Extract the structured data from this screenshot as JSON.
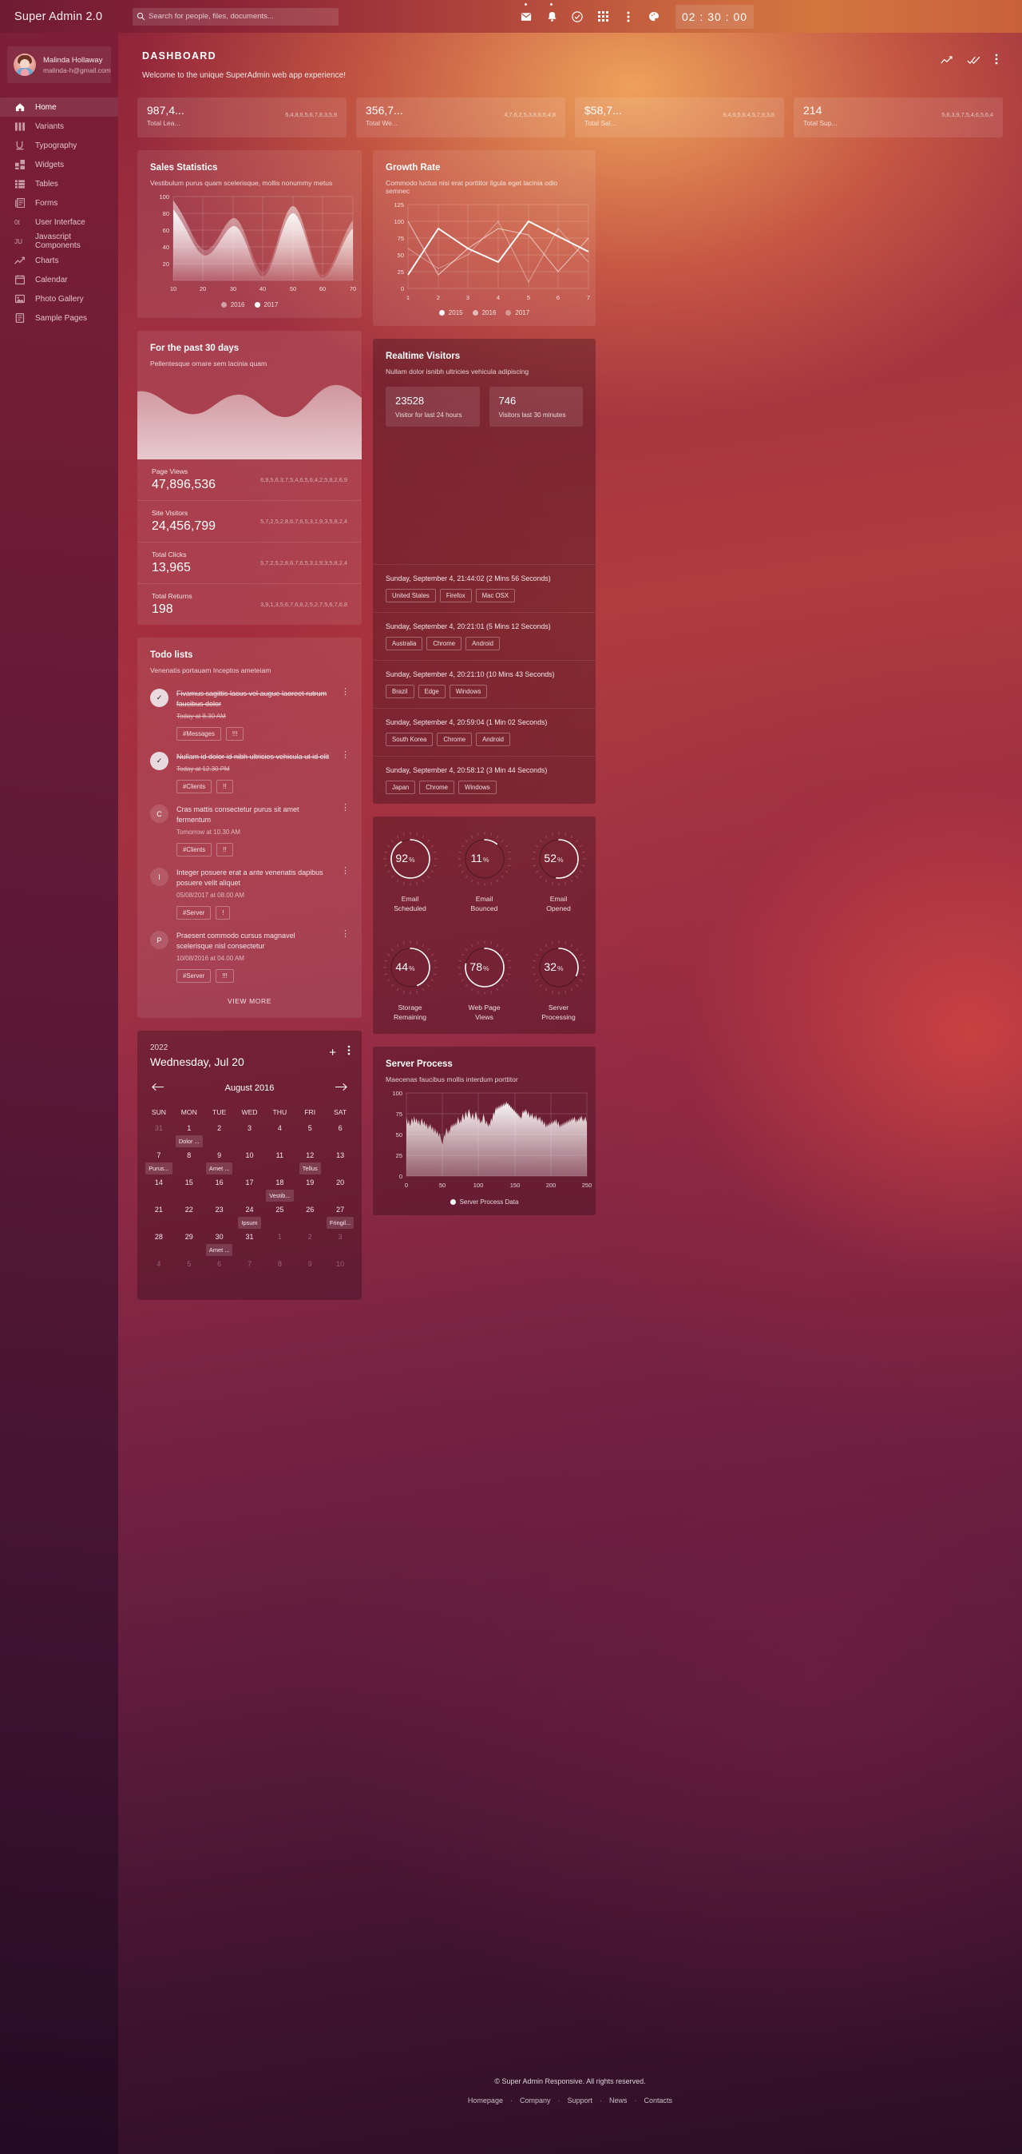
{
  "topbar": {
    "brand": "Super Admin 2.0",
    "search_placeholder": "Search for people, files, documents...",
    "clock": "02 : 30 : 00",
    "icons": [
      "mail-icon",
      "bell-icon",
      "check-circle-icon",
      "grid-apps-icon",
      "more-vertical-icon",
      "palette-icon"
    ]
  },
  "sidebar": {
    "user_name": "Malinda Hollaway",
    "user_email": "malinda-h@gmail.com",
    "items": [
      {
        "label": "Home",
        "icon": "home-icon",
        "active": true
      },
      {
        "label": "Variants",
        "icon": "columns-icon",
        "active": false
      },
      {
        "label": "Typography",
        "icon": "underline-u-icon",
        "active": false
      },
      {
        "label": "Widgets",
        "icon": "widgets-icon",
        "active": false
      },
      {
        "label": "Tables",
        "icon": "table-icon",
        "active": false
      },
      {
        "label": "Forms",
        "icon": "forms-icon",
        "active": false
      },
      {
        "label": "User Interface",
        "icon": "ui-icon",
        "active": false
      },
      {
        "label": "Javascript Components",
        "icon": "js-icon",
        "active": false
      },
      {
        "label": "Charts",
        "icon": "chart-line-icon",
        "active": false
      },
      {
        "label": "Calendar",
        "icon": "calendar-icon",
        "active": false
      },
      {
        "label": "Photo Gallery",
        "icon": "photo-icon",
        "active": false
      },
      {
        "label": "Sample Pages",
        "icon": "pages-icon",
        "active": false
      }
    ]
  },
  "page": {
    "title": "DASHBOARD",
    "subtitle": "Welcome to the unique SuperAdmin web app experience!"
  },
  "stats": [
    {
      "value": "987,4...",
      "label": "Total Lea...",
      "spark": "6,4,8,6,5,6,7,8,3,5,9"
    },
    {
      "value": "356,7...",
      "label": "Total We...",
      "spark": "4,7,6,2,5,3,8,6,6,4,8"
    },
    {
      "value": "$58,7...",
      "label": "Total Sal...",
      "spark": "9,4,6,5,6,4,5,7,9,3,6"
    },
    {
      "value": "214",
      "label": "Total Sup...",
      "spark": "5,6,3,9,7,5,4,6,5,6,4"
    }
  ],
  "sales": {
    "title": "Sales Statistics",
    "subtitle": "Vestibulum purus quam scelerisque, mollis nonummy metus",
    "legend": [
      "2016",
      "2017"
    ]
  },
  "growth": {
    "title": "Growth Rate",
    "subtitle": "Commodo luctus nisi erat porttitor ligula eget lacinia odio semnec",
    "legend": [
      "2015",
      "2016",
      "2017"
    ]
  },
  "past30": {
    "title": "For the past 30 days",
    "subtitle": "Pellentesque ornare sem lacinia quam",
    "metrics": [
      {
        "label": "Page Views",
        "value": "47,896,536",
        "spark": "6,9,5,6,3,7,5,4,6,5,6,4,2,5,8,2,6,9"
      },
      {
        "label": "Site Visitors",
        "value": "24,456,799",
        "spark": "5,7,2,5,2,8,6,7,6,5,3,1,9,3,5,8,2,4"
      },
      {
        "label": "Total Clicks",
        "value": "13,965",
        "spark": "5,7,2,5,2,8,6,7,6,5,3,1,9,3,5,8,2,4"
      },
      {
        "label": "Total Returns",
        "value": "198",
        "spark": "3,9,1,3,5,6,7,6,8,2,5,2,7,5,6,7,6,8"
      }
    ]
  },
  "todo": {
    "title": "Todo lists",
    "subtitle": "Venenatis portauam Inceptos ameteiam",
    "view_more": "VIEW MORE",
    "items": [
      {
        "avatar": "✓",
        "done": true,
        "text": "Fivamus sagittis lacus vel augue laoreet rutrum faucibus dolor",
        "time": "Today at 8.30 AM",
        "tags": [
          "#Messages",
          "!!!"
        ]
      },
      {
        "avatar": "✓",
        "done": true,
        "text": "Nullam id dolor id nibh ultricies vehicula ut id elit",
        "time": "Today at 12.30 PM",
        "tags": [
          "#Clients",
          "!!"
        ]
      },
      {
        "avatar": "C",
        "done": false,
        "text": "Cras mattis consectetur purus sit amet fermentum",
        "time": "Tomorrow at 10.30 AM",
        "tags": [
          "#Clients",
          "!!"
        ]
      },
      {
        "avatar": "I",
        "done": false,
        "text": "Integer posuere erat a ante venenatis dapibus posuere velit aliquet",
        "time": "05/08/2017 at 08.00 AM",
        "tags": [
          "#Server",
          "!"
        ]
      },
      {
        "avatar": "P",
        "done": false,
        "text": "Praesent commodo cursus magnavel scelerisque nisl consectetur",
        "time": "10/08/2016 at 04.00 AM",
        "tags": [
          "#Server",
          "!!!"
        ]
      }
    ]
  },
  "realtime": {
    "title": "Realtime Visitors",
    "subtitle": "Nullam dolor isnibh ultricies vehicula adipiscing",
    "cards": [
      {
        "number": "23528",
        "text": "Visitor for last 24 hours"
      },
      {
        "number": "746",
        "text": "Visitors last 30 minutes"
      }
    ],
    "rows": [
      {
        "time": "Sunday, September 4, 21:44:02 (2 Mins 56 Seconds)",
        "tags": [
          "United States",
          "Firefox",
          "Mac OSX"
        ]
      },
      {
        "time": "Sunday, September 4, 20:21:01 (5 Mins 12 Seconds)",
        "tags": [
          "Australia",
          "Chrome",
          "Android"
        ]
      },
      {
        "time": "Sunday, September 4, 20:21:10 (10 Mins 43 Seconds)",
        "tags": [
          "Brazil",
          "Edge",
          "Windows"
        ]
      },
      {
        "time": "Sunday, September 4, 20:59:04 (1 Min 02 Seconds)",
        "tags": [
          "South Korea",
          "Chrome",
          "Android"
        ]
      },
      {
        "time": "Sunday, September 4, 20:58:12 (3 Min 44 Seconds)",
        "tags": [
          "Japan",
          "Chrome",
          "Windows"
        ]
      }
    ]
  },
  "gauges": [
    {
      "pct": 92,
      "value": "92",
      "unit": "%",
      "label": "Email\nScheduled"
    },
    {
      "pct": 11,
      "value": "11",
      "unit": "%",
      "label": "Email\nBounced"
    },
    {
      "pct": 52,
      "value": "52",
      "unit": "%",
      "label": "Email\nOpened"
    },
    {
      "pct": 44,
      "value": "44",
      "unit": "%",
      "label": "Storage\nRemaining"
    },
    {
      "pct": 78,
      "value": "78",
      "unit": "%",
      "label": "Web Page\nViews"
    },
    {
      "pct": 32,
      "value": "32",
      "unit": "%",
      "label": "Server\nProcessing"
    }
  ],
  "calendar": {
    "year": "2022",
    "today": "Wednesday, Jul 20",
    "month": "August 2016",
    "add_label": "+",
    "dow": [
      "SUN",
      "MON",
      "TUE",
      "WED",
      "THU",
      "FRI",
      "SAT"
    ],
    "weeks": [
      [
        {
          "d": "31",
          "muted": true
        },
        {
          "d": "1",
          "ev": "Dolor ..."
        },
        {
          "d": "2"
        },
        {
          "d": "3"
        },
        {
          "d": "4"
        },
        {
          "d": "5"
        },
        {
          "d": "6"
        }
      ],
      [
        {
          "d": "7",
          "ev": "Purus..."
        },
        {
          "d": "8"
        },
        {
          "d": "9",
          "ev": "Amet ..."
        },
        {
          "d": "10"
        },
        {
          "d": "11"
        },
        {
          "d": "12",
          "ev": "Tellus"
        },
        {
          "d": "13"
        }
      ],
      [
        {
          "d": "14"
        },
        {
          "d": "15"
        },
        {
          "d": "16"
        },
        {
          "d": "17"
        },
        {
          "d": "18",
          "ev": "Vestib..."
        },
        {
          "d": "19"
        },
        {
          "d": "20"
        }
      ],
      [
        {
          "d": "21"
        },
        {
          "d": "22"
        },
        {
          "d": "23"
        },
        {
          "d": "24",
          "ev": "Ipsum"
        },
        {
          "d": "25"
        },
        {
          "d": "26"
        },
        {
          "d": "27",
          "ev": "Fringil..."
        }
      ],
      [
        {
          "d": "28"
        },
        {
          "d": "29"
        },
        {
          "d": "30",
          "ev": "Amet ..."
        },
        {
          "d": "31"
        },
        {
          "d": "1",
          "muted": true
        },
        {
          "d": "2",
          "muted": true
        },
        {
          "d": "3",
          "muted": true
        }
      ],
      [
        {
          "d": "4",
          "muted": true
        },
        {
          "d": "5",
          "muted": true
        },
        {
          "d": "6",
          "muted": true
        },
        {
          "d": "7",
          "muted": true
        },
        {
          "d": "8",
          "muted": true
        },
        {
          "d": "9",
          "muted": true
        },
        {
          "d": "10",
          "muted": true
        }
      ]
    ]
  },
  "server": {
    "title": "Server Process",
    "subtitle": "Maecenas faucibus mollis interdum porttitor",
    "legend": "Server Process Data"
  },
  "footer": {
    "copyright": "© Super Admin Responsive. All rights reserved.",
    "links": [
      "Homepage",
      "Company",
      "Support",
      "News",
      "Contacts"
    ]
  },
  "chart_data": [
    {
      "type": "area",
      "title": "Sales Statistics",
      "name": "sales-statistics-chart",
      "xlabel": "",
      "ylabel": "",
      "xlim": [
        10,
        70
      ],
      "ylim": [
        0,
        100
      ],
      "xticks": [
        10,
        20,
        30,
        40,
        50,
        60,
        70
      ],
      "yticks": [
        20,
        40,
        60,
        80,
        100
      ],
      "grid": true,
      "legend_position": "bottom",
      "series": [
        {
          "name": "2016",
          "x": [
            10,
            15,
            20,
            25,
            30,
            35,
            40,
            45,
            50,
            55,
            60,
            65,
            70
          ],
          "values": [
            90,
            60,
            38,
            50,
            76,
            62,
            22,
            50,
            88,
            60,
            18,
            40,
            70
          ]
        },
        {
          "name": "2017",
          "x": [
            10,
            15,
            20,
            25,
            30,
            35,
            40,
            45,
            50,
            55,
            60,
            65,
            70
          ],
          "values": [
            80,
            50,
            30,
            42,
            69,
            54,
            12,
            42,
            80,
            50,
            10,
            32,
            62
          ]
        }
      ]
    },
    {
      "type": "line",
      "title": "Growth Rate",
      "name": "growth-rate-chart",
      "xlabel": "",
      "ylabel": "",
      "xlim": [
        1,
        7
      ],
      "ylim": [
        0,
        125
      ],
      "xticks": [
        1,
        2,
        3,
        4,
        5,
        6,
        7
      ],
      "yticks": [
        0,
        25,
        50,
        75,
        100,
        125
      ],
      "grid": true,
      "legend_position": "bottom",
      "categories": [
        1,
        2,
        3,
        4,
        5,
        6,
        7
      ],
      "series": [
        {
          "name": "2015",
          "values": [
            60,
            30,
            50,
            100,
            10,
            89,
            40
          ]
        },
        {
          "name": "2016",
          "values": [
            100,
            20,
            60,
            90,
            80,
            25,
            75
          ]
        },
        {
          "name": "2017",
          "values": [
            20,
            90,
            60,
            40,
            100,
            10,
            55
          ]
        }
      ]
    },
    {
      "type": "area",
      "title": "For the past 30 days",
      "name": "past-30-days-wave-chart",
      "grid": false,
      "series": [
        {
          "name": "trend",
          "values": [
            72,
            60,
            48,
            55,
            66,
            52,
            40,
            52,
            70,
            58,
            46,
            58,
            74
          ]
        }
      ]
    },
    {
      "type": "area",
      "title": "Server Process",
      "name": "server-process-chart",
      "xlabel": "",
      "ylabel": "",
      "xlim": [
        0,
        250
      ],
      "ylim": [
        0,
        100
      ],
      "xticks": [
        0,
        50,
        100,
        150,
        200,
        250
      ],
      "yticks": [
        0,
        25,
        50,
        75,
        100
      ],
      "grid": true,
      "legend_position": "bottom",
      "series": [
        {
          "name": "Server Process Data",
          "values": [
            71,
            66,
            62,
            68,
            63,
            60,
            65,
            70,
            67,
            63,
            72,
            68,
            64,
            70,
            66,
            62,
            68,
            64,
            60,
            66,
            70,
            65,
            61,
            67,
            63,
            59,
            64,
            60,
            56,
            62,
            58,
            63,
            59,
            55,
            60,
            56,
            52,
            58,
            54,
            50,
            55,
            51,
            47,
            52,
            48,
            44,
            40,
            38,
            45,
            50,
            47,
            53,
            58,
            54,
            50,
            56,
            52,
            57,
            62,
            58,
            63,
            59,
            64,
            60,
            65,
            61,
            66,
            71,
            67,
            63,
            68,
            64,
            70,
            75,
            71,
            67,
            73,
            78,
            74,
            70,
            76,
            81,
            77,
            73,
            68,
            72,
            76,
            71,
            67,
            73,
            78,
            74,
            70,
            66,
            71,
            67,
            63,
            68,
            64,
            70,
            75,
            71,
            66,
            62,
            67,
            63,
            59,
            64,
            60,
            65,
            70,
            66,
            72,
            77,
            73,
            78,
            83,
            79,
            84,
            80,
            85,
            81,
            86,
            82,
            87,
            83,
            88,
            84,
            89,
            85,
            90,
            86,
            88,
            84,
            86,
            82,
            84,
            80,
            82,
            78,
            80,
            76,
            78,
            74,
            76,
            72,
            74,
            70,
            72,
            68,
            74,
            79,
            75,
            80,
            76,
            81,
            77,
            73,
            78,
            74,
            70,
            75,
            71,
            76,
            72,
            68,
            73,
            69,
            74,
            70,
            66,
            71,
            67,
            72,
            68,
            64,
            69,
            65,
            61,
            66,
            62,
            58,
            63,
            59,
            64,
            60,
            65,
            61,
            66,
            62,
            67,
            63,
            68,
            64,
            69,
            65,
            61,
            66,
            62,
            58,
            63,
            59,
            64,
            60,
            65,
            61,
            66,
            62,
            67,
            63,
            68,
            64,
            69,
            65,
            70,
            66,
            71,
            67,
            72,
            68,
            64,
            69,
            65,
            70,
            66,
            72,
            68,
            73,
            69,
            65,
            70,
            66,
            72,
            68,
            64
          ]
        }
      ]
    }
  ]
}
